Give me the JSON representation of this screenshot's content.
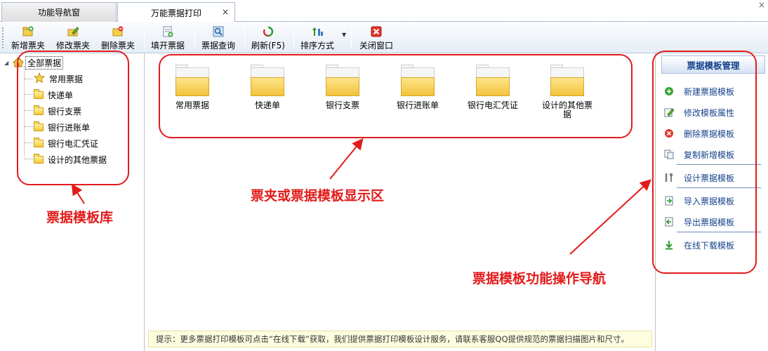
{
  "tabs": [
    {
      "label": "功能导航窗",
      "active": false
    },
    {
      "label": "万能票据打印",
      "active": true
    }
  ],
  "tab_close": "×",
  "window_close": "×",
  "toolbar": {
    "new_folder": "新增票夹",
    "edit_folder": "修改票夹",
    "delete_folder": "删除票夹",
    "fill_ticket": "填开票据",
    "query_ticket": "票据查询",
    "refresh": "刷新(F5)",
    "sort": "排序方式",
    "close_window": "关闭窗口"
  },
  "tree": {
    "root": "全部票据",
    "items": [
      "常用票据",
      "快递单",
      "银行支票",
      "银行进账单",
      "银行电汇凭证",
      "设计的其他票据"
    ]
  },
  "folders": [
    "常用票据",
    "快递单",
    "银行支票",
    "银行进账单",
    "银行电汇凭证",
    "设计的其他票据"
  ],
  "tip": "提示：更多票据打印模板可点击“在线下载”获取，我们提供票据打印模板设计服务，请联系客服QQ提供规范的票据扫描图片和尺寸。",
  "right_panel": {
    "title": "票据模板管理",
    "items": [
      "新建票据模板",
      "修改模板属性",
      "删除票据模板",
      "复制新增模板",
      "设计票据模板",
      "导入票据模板",
      "导出票据模板",
      "在线下载模板"
    ]
  },
  "annotations": {
    "library": "票据模板库",
    "display_area": "票夹或票据模板显示区",
    "nav": "票据模板功能操作导航"
  },
  "colors": {
    "annotation_red": "#e31b1b",
    "panel_link_blue": "#15428b",
    "folder_yellow": "#f3c23c"
  }
}
